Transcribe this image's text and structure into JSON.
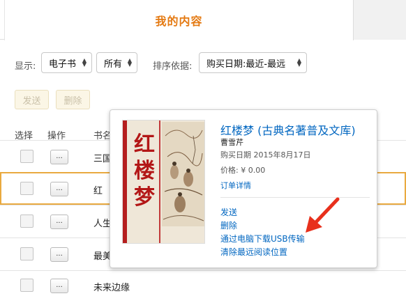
{
  "tabs": {
    "active_label": "我的内容"
  },
  "filters": {
    "display_label": "显示:",
    "type_value": "电子书",
    "scope_value": "所有",
    "sort_label": "排序依据:",
    "sort_value": "购买日期:最近-最远"
  },
  "actions": {
    "send_label": "发送",
    "delete_label": "删除"
  },
  "table": {
    "headers": {
      "select": "选择",
      "operate": "操作",
      "title": "书名"
    },
    "more_label": "...",
    "rows": [
      {
        "title": "三国"
      },
      {
        "title": "红"
      },
      {
        "title": "人生"
      },
      {
        "title": "最美"
      },
      {
        "title": "未来边缘"
      }
    ]
  },
  "popover": {
    "title": "红楼梦 (古典名著普及文库)",
    "author": "曹雪芹",
    "purchase_date": "购买日期 2015年8月17日",
    "price": "价格:  ¥ 0.00",
    "order_details": "订单详情",
    "cover_title": [
      "红",
      "楼",
      "梦"
    ],
    "menu": [
      "发送",
      "删除",
      "通过电脑下载USB传输",
      "清除最远阅读位置"
    ]
  },
  "colors": {
    "accent": "#e47911",
    "link": "#0066c0",
    "selected_border": "#e9a93f",
    "annotation": "#e8301c"
  },
  "icons": {
    "dropdown": "updown-arrow-icon",
    "annotation": "red-arrow-icon"
  }
}
